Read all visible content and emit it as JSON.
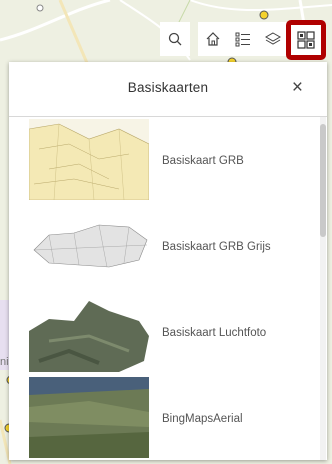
{
  "toolbar": {
    "buttons": [
      {
        "icon": "search-icon"
      },
      {
        "icon": "home-icon"
      },
      {
        "icon": "legend-list-icon"
      },
      {
        "icon": "layers-icon"
      },
      {
        "icon": "basemap-gallery-icon",
        "active": true
      }
    ],
    "active_color": "#b00000"
  },
  "panel": {
    "title": "Basiskaarten",
    "close_label": "×",
    "items": [
      {
        "label": "Basiskaart GRB"
      },
      {
        "label": "Basiskaart GRB Grijs"
      },
      {
        "label": "Basiskaart Luchtfoto"
      },
      {
        "label": "BingMapsAerial"
      }
    ]
  },
  "map": {
    "partial_label": "nis"
  }
}
